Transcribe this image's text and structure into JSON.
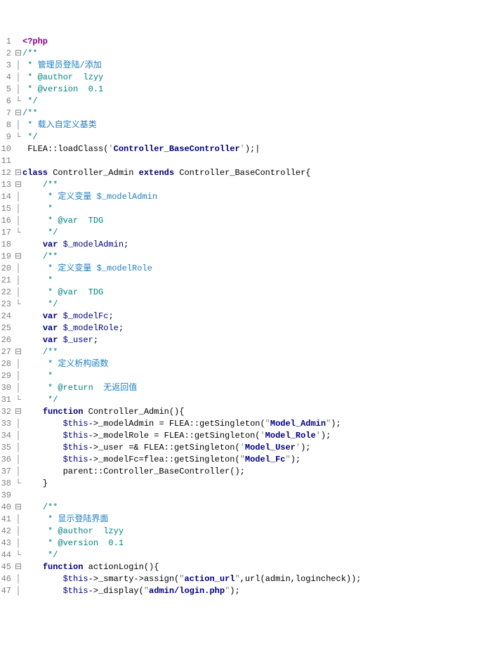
{
  "lines": [
    {
      "n": 1,
      "f": "",
      "html": "<span class='kw2'>&lt;?php</span>"
    },
    {
      "n": 2,
      "f": "⊟",
      "html": "<span class='cm'>/**</span>"
    },
    {
      "n": 3,
      "f": "│",
      "html": "<span class='cm'> *</span> <span class='cm-txt'>管理员登陆/添加</span>"
    },
    {
      "n": 4,
      "f": "│",
      "html": "<span class='cm'> * @author  lzyy</span>"
    },
    {
      "n": 5,
      "f": "│",
      "html": "<span class='cm'> * @version  0.1</span>"
    },
    {
      "n": 6,
      "f": "└",
      "html": "<span class='cm'> */</span>"
    },
    {
      "n": 7,
      "f": "⊟",
      "html": "<span class='cm'>/**</span>"
    },
    {
      "n": 8,
      "f": "│",
      "html": "<span class='cm'> *</span> <span class='cm-txt'>载入自定义基类</span>"
    },
    {
      "n": 9,
      "f": "└",
      "html": "<span class='cm'> */</span>"
    },
    {
      "n": 10,
      "f": "",
      "html": " FLEA::loadClass(<span class='str'>'</span><span class='str-b'>Controller_BaseController</span><span class='str'>'</span>);|"
    },
    {
      "n": 11,
      "f": "",
      "html": ""
    },
    {
      "n": 12,
      "f": "⊟",
      "html": "<span class='kw'>class</span> Controller_Admin <span class='kw'>extends</span> Controller_BaseController{"
    },
    {
      "n": 13,
      "f": "⊟",
      "html": "    <span class='cm'>/**</span>"
    },
    {
      "n": 14,
      "f": "│",
      "html": "<span class='cm'>     *</span> <span class='cm-txt'>定义变量 $_modelAdmin</span>"
    },
    {
      "n": 15,
      "f": "│",
      "html": "<span class='cm'>     *</span>"
    },
    {
      "n": 16,
      "f": "│",
      "html": "<span class='cm'>     * @var  TDG</span>"
    },
    {
      "n": 17,
      "f": "└",
      "html": "<span class='cm'>     */</span>"
    },
    {
      "n": 18,
      "f": "",
      "html": "    <span class='kw'>var</span> <span class='var'>$_modelAdmin</span>;"
    },
    {
      "n": 19,
      "f": "⊟",
      "html": "    <span class='cm'>/**</span>"
    },
    {
      "n": 20,
      "f": "│",
      "html": "<span class='cm'>     *</span> <span class='cm-txt'>定义变量 $_modelRole</span>"
    },
    {
      "n": 21,
      "f": "│",
      "html": "<span class='cm'>     *</span>"
    },
    {
      "n": 22,
      "f": "│",
      "html": "<span class='cm'>     * @var  TDG</span>"
    },
    {
      "n": 23,
      "f": "└",
      "html": "<span class='cm'>     */</span>"
    },
    {
      "n": 24,
      "f": "",
      "html": "    <span class='kw'>var</span> <span class='var'>$_modelFc</span>;"
    },
    {
      "n": 25,
      "f": "",
      "html": "    <span class='kw'>var</span> <span class='var'>$_modelRole</span>;"
    },
    {
      "n": 26,
      "f": "",
      "html": "    <span class='kw'>var</span> <span class='var'>$_user</span>;"
    },
    {
      "n": 27,
      "f": "⊟",
      "html": "    <span class='cm'>/**</span>"
    },
    {
      "n": 28,
      "f": "│",
      "html": "<span class='cm'>     *</span> <span class='cm-txt'>定义析构函数</span>"
    },
    {
      "n": 29,
      "f": "│",
      "html": "<span class='cm'>     *</span>"
    },
    {
      "n": 30,
      "f": "│",
      "html": "<span class='cm'>     * @return</span>  <span class='cm-txt'>无返回值</span>"
    },
    {
      "n": 31,
      "f": "└",
      "html": "<span class='cm'>     */</span>"
    },
    {
      "n": 32,
      "f": "⊟",
      "html": "    <span class='kw'>function</span> Controller_Admin(){"
    },
    {
      "n": 33,
      "f": "│",
      "html": "        <span class='var'>$this</span>-&gt;_modelAdmin = FLEA::getSingleton(<span class='str'>\"</span><span class='str-b'>Model_Admin</span><span class='str'>\"</span>);"
    },
    {
      "n": 34,
      "f": "│",
      "html": "        <span class='var'>$this</span>-&gt;_modelRole = FLEA::getSingleton(<span class='str'>'</span><span class='str-b'>Model_Role</span><span class='str'>'</span>);"
    },
    {
      "n": 35,
      "f": "│",
      "html": "        <span class='var'>$this</span>-&gt;_user =&amp; FLEA::getSingleton(<span class='str'>'</span><span class='str-b'>Model_User</span><span class='str'>'</span>);"
    },
    {
      "n": 36,
      "f": "│",
      "html": "        <span class='var'>$this</span>-&gt;_modelFc=flea::getSingleton(<span class='str'>\"</span><span class='str-b'>Model_Fc</span><span class='str'>\"</span>);"
    },
    {
      "n": 37,
      "f": "│",
      "html": "        parent::Controller_BaseController();"
    },
    {
      "n": 38,
      "f": "└",
      "html": "    }"
    },
    {
      "n": 39,
      "f": "",
      "html": ""
    },
    {
      "n": 40,
      "f": "⊟",
      "html": "    <span class='cm'>/**</span>"
    },
    {
      "n": 41,
      "f": "│",
      "html": "<span class='cm'>     *</span> <span class='cm-txt'>显示登陆界面</span>"
    },
    {
      "n": 42,
      "f": "│",
      "html": "<span class='cm'>     * @author  lzyy</span>"
    },
    {
      "n": 43,
      "f": "│",
      "html": "<span class='cm'>     * @version  0.1</span>"
    },
    {
      "n": 44,
      "f": "└",
      "html": "<span class='cm'>     */</span>"
    },
    {
      "n": 45,
      "f": "⊟",
      "html": "    <span class='kw'>function</span> actionLogin(){"
    },
    {
      "n": 46,
      "f": "│",
      "html": "        <span class='var'>$this</span>-&gt;_smarty-&gt;assign(<span class='str'>\"</span><span class='str-b'>action_url</span><span class='str'>\"</span>,url(admin,logincheck));"
    },
    {
      "n": 47,
      "f": "│",
      "html": "        <span class='var'>$this</span>-&gt;_display(<span class='str'>\"</span><span class='str-b'>admin/login.php</span><span class='str'>\"</span>);"
    }
  ]
}
